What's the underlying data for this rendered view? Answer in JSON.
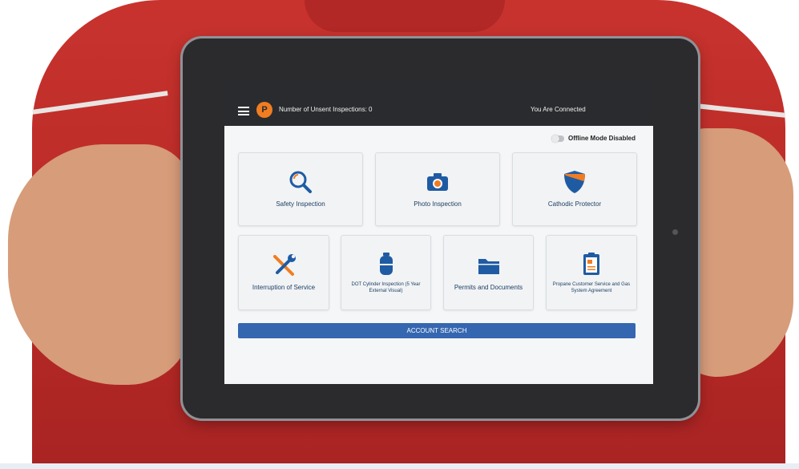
{
  "header": {
    "logo_text": "P",
    "unsent_label": "Number of Unsent Inspections: 0",
    "connection_status": "You Are Connected"
  },
  "offline_mode": {
    "label": "Offline Mode Disabled",
    "enabled": false
  },
  "tiles": [
    {
      "label": "Safety Inspection",
      "icon": "magnifying-glass-icon"
    },
    {
      "label": "Photo Inspection",
      "icon": "camera-icon"
    },
    {
      "label": "Cathodic Protector",
      "icon": "shield-icon"
    },
    {
      "label": "Interruption of Service",
      "icon": "wrench-screwdriver-icon"
    },
    {
      "label": "DOT Cylinder Inspection (5 Year External Visual)",
      "icon": "propane-cylinder-icon"
    },
    {
      "label": "Permits and Documents",
      "icon": "folder-icon"
    },
    {
      "label": "Propane Customer Service and Gas System Agreement",
      "icon": "clipboard-icon"
    }
  ],
  "account_search": {
    "label": "ACCOUNT SEARCH"
  },
  "colors": {
    "accent_blue": "#3566b0",
    "icon_blue": "#1f5ba3",
    "accent_orange": "#f07d22",
    "topbar": "#2a2b2e"
  }
}
